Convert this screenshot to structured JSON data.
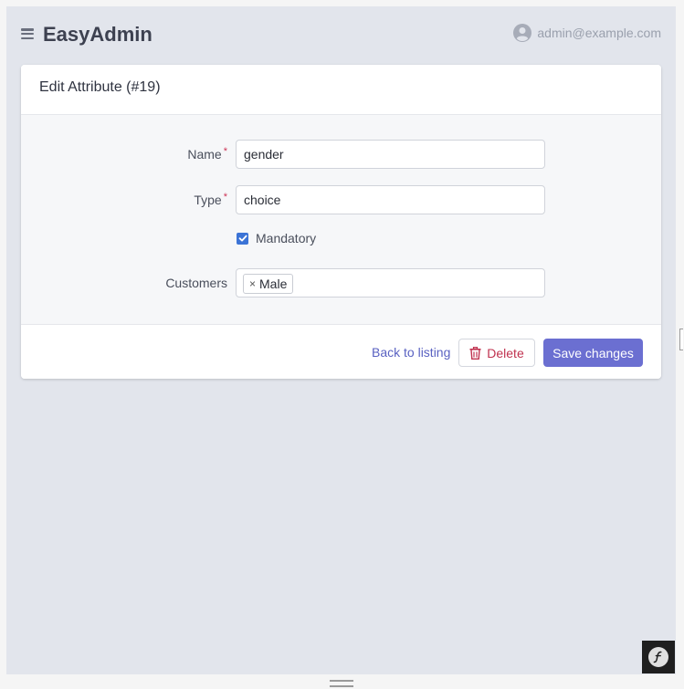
{
  "header": {
    "brand": "EasyAdmin",
    "user_email": "admin@example.com",
    "menu_icon": "hamburger-icon",
    "avatar_icon": "user-avatar-icon"
  },
  "card": {
    "title": "Edit Attribute (#19)",
    "fields": {
      "name": {
        "label": "Name",
        "required_mark": "*",
        "value": "gender"
      },
      "type": {
        "label": "Type",
        "required_mark": "*",
        "value": "choice"
      },
      "mandatory": {
        "label": "Mandatory",
        "checked": true
      },
      "customers": {
        "label": "Customers",
        "tags": [
          {
            "remove": "×",
            "label": "Male"
          }
        ]
      }
    },
    "actions": {
      "back_label": "Back to listing",
      "delete_label": "Delete",
      "save_label": "Save changes",
      "delete_icon": "trash-icon"
    }
  },
  "colors": {
    "primary": "#6b6fd1",
    "danger": "#c0324f",
    "link": "#5a62c2",
    "background": "#e2e5ec"
  }
}
